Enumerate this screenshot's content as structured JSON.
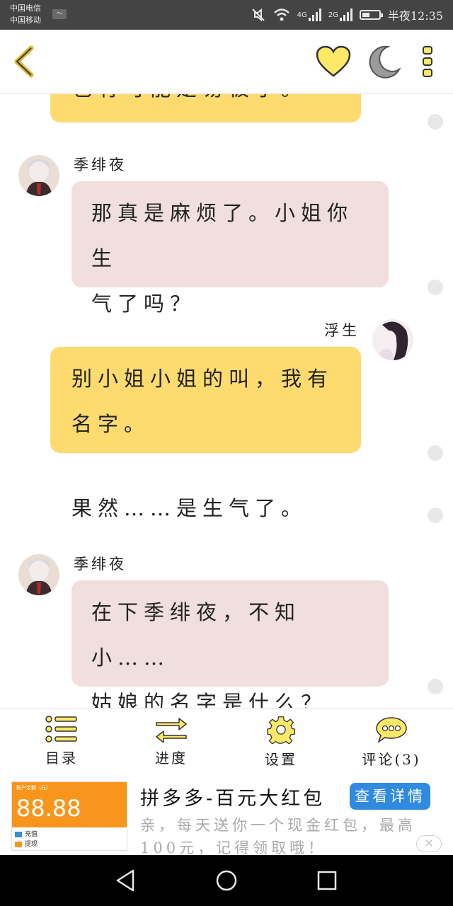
{
  "status_bar": {
    "carrier_1": "中国电信",
    "carrier_2": "中国移动",
    "network_1": "4G",
    "network_2": "2G",
    "time": "半夜12:35"
  },
  "header": {
    "back_icon": "chevron-left-icon",
    "favorite_icon": "heart-icon",
    "night_icon": "moon-icon",
    "menu_icon": "more-vertical-icon",
    "accent_color": "#fddb6e"
  },
  "chat": {
    "partial_top_text": "也有可能是易被了。",
    "messages": [
      {
        "speaker": "季绯夜",
        "text": [
          "那真是麻烦了。小姐你生",
          "气了吗？"
        ]
      },
      {
        "speaker": "浮生",
        "text": [
          "别小姐小姐的叫，我有",
          "名字。"
        ]
      },
      {
        "narration": "果然……是生气了。"
      },
      {
        "speaker": "季绯夜",
        "text": [
          "在下季绯夜，不知小……",
          "姑娘的名字是什么？"
        ]
      }
    ],
    "bubble_colors": {
      "self": "#fddb6e",
      "other": "#f1dede"
    }
  },
  "bottom_nav": [
    {
      "label": "目录",
      "icon": "list-icon"
    },
    {
      "label": "进度",
      "icon": "swap-arrows-icon"
    },
    {
      "label": "设置",
      "icon": "gear-icon"
    },
    {
      "label": "评论(3)",
      "icon": "comment-icon"
    }
  ],
  "ad": {
    "image_account_label": "账户余额（元）",
    "image_amount": "88.88",
    "image_row_1": "充值",
    "image_row_2": "提现",
    "title": "拼多多-百元大红包",
    "button": "查看详情",
    "description": "亲，每天送你一个现金红包，最高100元，记得领取哦！",
    "close": "×"
  },
  "system_nav": [
    "back-triangle-icon",
    "home-circle-icon",
    "recents-square-icon"
  ]
}
